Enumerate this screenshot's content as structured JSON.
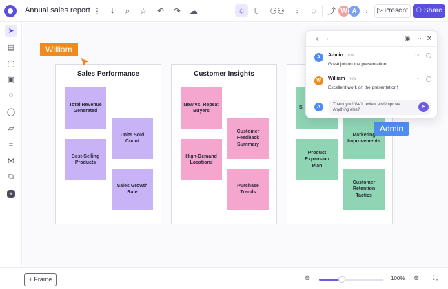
{
  "header": {
    "title": "Annual sales report",
    "present_label": "Present",
    "share_label": "Share",
    "present_icon": "play-icon",
    "share_icon": "user-add-icon",
    "avatars": [
      {
        "initial": "W",
        "color": "#f2a0a0"
      },
      {
        "initial": "A",
        "color": "#7ba2f2"
      }
    ]
  },
  "frames": [
    {
      "title": "Sales Performance",
      "stickies": [
        "Total Revenue Generated",
        "Units Sold Count",
        "Best-Selling Products",
        "Sales Growth Rate"
      ]
    },
    {
      "title": "Customer Insights",
      "stickies": [
        "New vs. Repeat Buyers",
        "Customer Feedback Summary",
        "High-Demand Locations",
        "Purchase Trends"
      ]
    },
    {
      "title": "",
      "stickies": [
        "S",
        "Marketing Improvements",
        "Product Expansion Plan",
        "Customer Retention Tactics"
      ]
    }
  ],
  "cursors": [
    {
      "name": "William",
      "color": "#f08a1c"
    },
    {
      "name": "Admin",
      "color": "#4f8df0"
    }
  ],
  "comments": {
    "items": [
      {
        "initial": "A",
        "author": "Admin",
        "time": "now",
        "text": "Great job on the presentation!",
        "color": "#4f8df0"
      },
      {
        "initial": "W",
        "author": "William",
        "time": "now",
        "text": "Excellent work on the presentation!",
        "color": "#f08a1c"
      }
    ],
    "reply": {
      "initial": "A",
      "text": "Thank you! We'll review and improve. Anything else?",
      "color": "#4f8df0"
    }
  },
  "footer": {
    "frame_label": "Frame",
    "zoom": "100%",
    "zoom_level": 0.35
  },
  "colors": {
    "accent": "#5b4fe0",
    "sticky_purple": "#c8b3f6",
    "sticky_pink": "#f4a6cf",
    "sticky_green": "#8fd5b4"
  }
}
